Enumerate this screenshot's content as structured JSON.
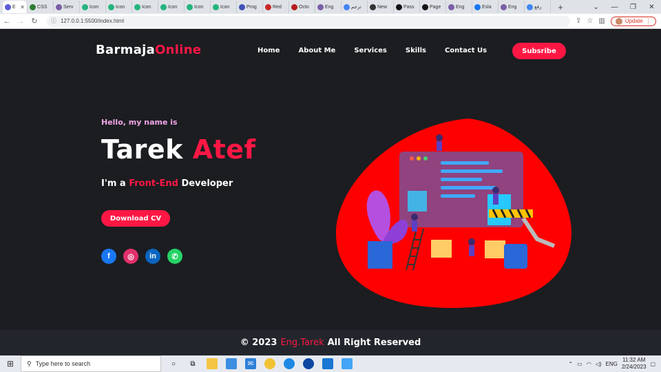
{
  "browser": {
    "tabs": [
      {
        "label": "E",
        "color": "#5b5bd6",
        "active": true
      },
      {
        "label": "CSS",
        "color": "#2e7d32"
      },
      {
        "label": "Serv",
        "color": "#7b5ea7"
      },
      {
        "label": "Icon",
        "color": "#24b47e"
      },
      {
        "label": "Icon",
        "color": "#24b47e"
      },
      {
        "label": "Icon",
        "color": "#24b47e"
      },
      {
        "label": "Icon",
        "color": "#24b47e"
      },
      {
        "label": "Icon",
        "color": "#24b47e"
      },
      {
        "label": "Icon",
        "color": "#24b47e"
      },
      {
        "label": "Prog",
        "color": "#3f51b5"
      },
      {
        "label": "Red",
        "color": "#c62828"
      },
      {
        "label": "Octo",
        "color": "#b71c1c"
      },
      {
        "label": "Eng",
        "color": "#7b5ea7"
      },
      {
        "label": "ترجم",
        "color": "#4285f4"
      },
      {
        "label": "New",
        "color": "#333333"
      },
      {
        "label": "Pass",
        "color": "#111111"
      },
      {
        "label": "Page",
        "color": "#111111"
      },
      {
        "label": "Eng",
        "color": "#7b5ea7"
      },
      {
        "label": "Esla",
        "color": "#1877f2"
      },
      {
        "label": "Eng",
        "color": "#7b5ea7"
      },
      {
        "label": "رفع",
        "color": "#4285f4"
      }
    ],
    "new_tab": "+",
    "url": "127.0.0.1:5500/index.html",
    "update_label": "Update"
  },
  "site": {
    "logo_part1": "Barmaja",
    "logo_part2": "Online",
    "nav": [
      "Home",
      "About Me",
      "Services",
      "Skills",
      "Contact Us"
    ],
    "subscribe": "Subsribe",
    "hello": "Hello, my name is",
    "first_name": "Tarek",
    "last_name": "Atef",
    "role_prefix": "I'm a",
    "role_highlight": "Front-End",
    "role_suffix": "Developer",
    "cv_button": "Download CV",
    "social": [
      {
        "icon": "facebook-icon",
        "glyph": "f",
        "color": "#1877f2"
      },
      {
        "icon": "instagram-icon",
        "glyph": "◎",
        "color": "#e1306c"
      },
      {
        "icon": "linkedin-icon",
        "glyph": "in",
        "color": "#0a66c2"
      },
      {
        "icon": "whatsapp-icon",
        "glyph": "✆",
        "color": "#25d366"
      }
    ],
    "footer_prefix": "© 2023",
    "footer_name": "Eng.Tarek",
    "footer_suffix": "All Right Reserved",
    "accent": "#ff1744"
  },
  "taskbar": {
    "search_placeholder": "Type here to search",
    "lang": "ENG",
    "time": "11:32 AM",
    "date": "2/24/2023"
  }
}
